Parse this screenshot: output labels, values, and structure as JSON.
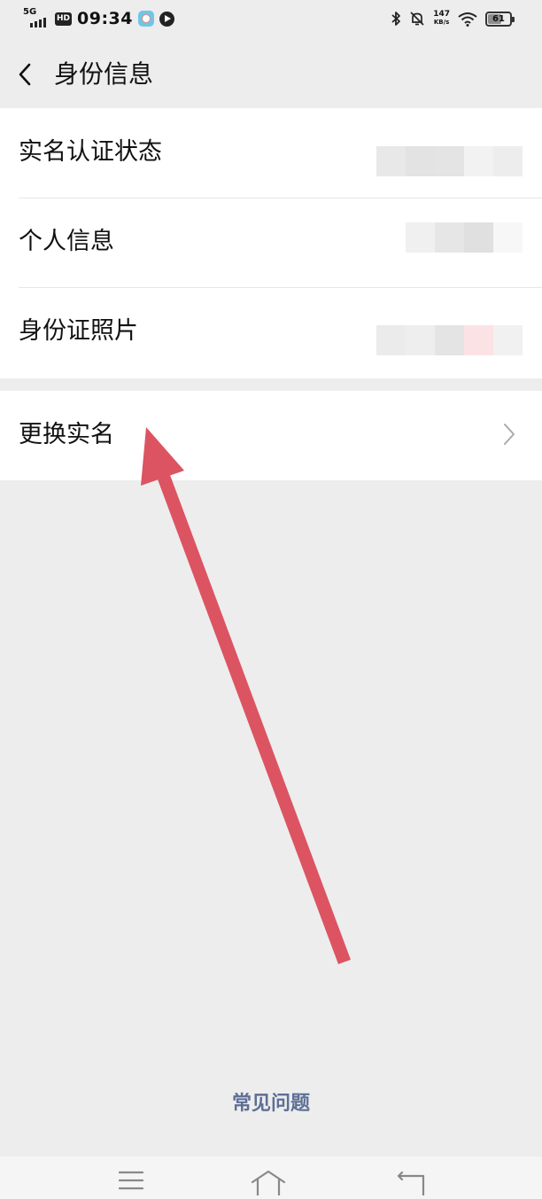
{
  "status_bar": {
    "network": "5G",
    "hd": "HD",
    "time": "09:34",
    "net_speed_value": "147",
    "net_speed_unit": "KB/s",
    "battery_level": 61,
    "battery_text": "61",
    "icons": [
      "signal-icon",
      "app-notification-icon",
      "video-app-icon",
      "bluetooth-icon",
      "mute-bell-icon",
      "wifi-icon",
      "battery-icon"
    ]
  },
  "header": {
    "title": "身份信息",
    "back_icon": "chevron-left-icon"
  },
  "info_group": {
    "items": [
      {
        "label": "实名认证状态",
        "value_state": "pixelated"
      },
      {
        "label": "个人信息",
        "value_state": "pixelated"
      },
      {
        "label": "身份证照片",
        "value_state": "pixelated"
      }
    ]
  },
  "action_group": {
    "items": [
      {
        "label": "更换实名",
        "icon": "chevron-right-icon"
      }
    ]
  },
  "faq_link": "常见问题",
  "nav_bar": {
    "icons": [
      "menu-icon",
      "home-icon",
      "back-icon"
    ]
  },
  "colors": {
    "background": "#ededed",
    "card": "#ffffff",
    "link": "#5d6f95",
    "annotation_arrow": "#dc5462"
  }
}
